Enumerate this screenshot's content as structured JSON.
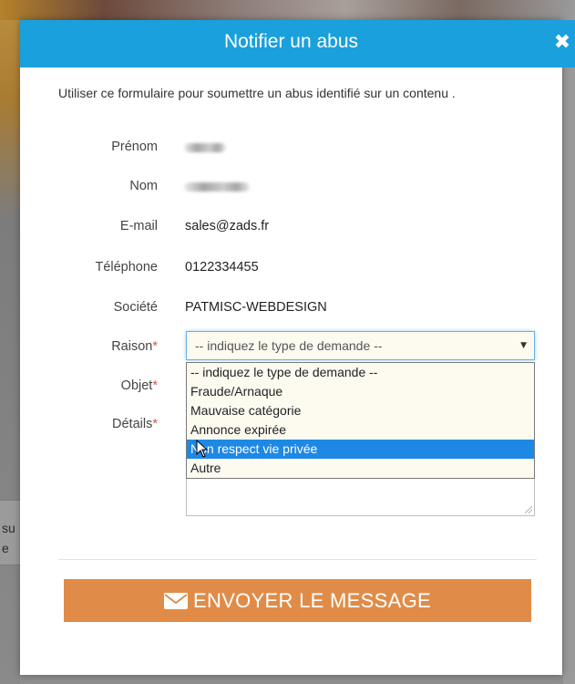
{
  "background": {
    "partial_text_1": "su",
    "partial_text_2": "e"
  },
  "modal": {
    "title": "Notifier un abus",
    "close_icon": "close-icon",
    "intro": "Utiliser ce formulaire pour soumettre un abus identifié sur un contenu ."
  },
  "fields": {
    "prenom_label": "Prénom",
    "nom_label": "Nom",
    "email_label": "E-mail",
    "email_value": "sales@zads.fr",
    "telephone_label": "Téléphone",
    "telephone_value": "0122334455",
    "societe_label": "Société",
    "societe_value": "PATMISC-WEBDESIGN",
    "raison_label": "Raison",
    "objet_label": "Objet",
    "details_label": "Détails",
    "required_mark": "*"
  },
  "raison_select": {
    "selected": "-- indiquez le type de demande --",
    "options": [
      "-- indiquez le type de demande --",
      "Fraude/Arnaque",
      "Mauvaise catégorie",
      "Annonce expirée",
      "Non respect vie privée",
      "Autre"
    ],
    "highlighted_index": 4
  },
  "submit": {
    "label": "ENVOYER LE MESSAGE",
    "icon": "envelope-icon"
  },
  "colors": {
    "header": "#1aa0dc",
    "button": "#e08c48",
    "highlight": "#1e88e5",
    "required": "#d9534f"
  }
}
